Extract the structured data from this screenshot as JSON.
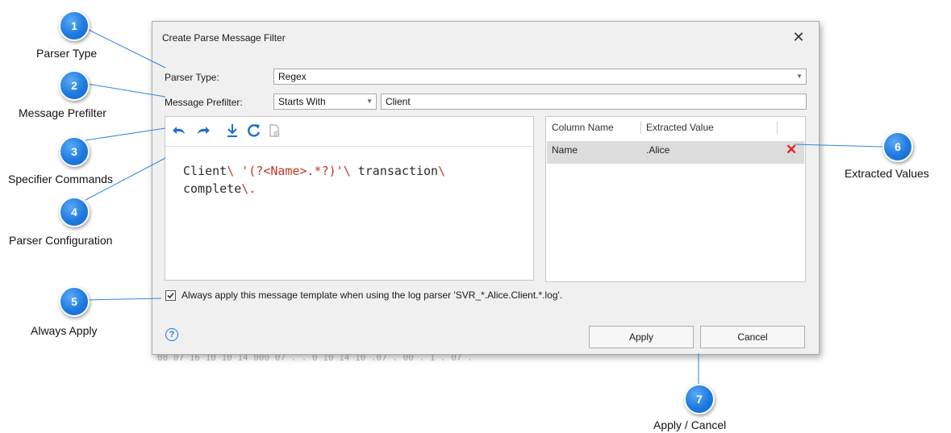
{
  "dialog": {
    "title": "Create Parse Message Filter",
    "close_glyph": "✕",
    "parser_type": {
      "label": "Parser Type:",
      "value": "Regex"
    },
    "message_prefilter": {
      "label": "Message Prefilter:",
      "mode": "Starts With",
      "value": "Client"
    },
    "editor": {
      "line1_a": "Client",
      "line1_b": "\\",
      " line1_c": "",
      "code_line1": [
        "Client",
        "\\ ",
        "'(?<Name>.*?)'",
        "\\ ",
        "transaction",
        "\\"
      ],
      "code_line2": [
        "complete",
        "\\."
      ]
    },
    "values_table": {
      "columns": [
        "Column Name",
        "Extracted Value"
      ],
      "rows": [
        {
          "name": "Name",
          "value": ".Alice"
        }
      ],
      "delete_glyph": "✕"
    },
    "always_apply": {
      "checked": true,
      "label": "Always apply this message template when using the log parser 'SVR_*.Alice.Client.*.log'."
    },
    "help_glyph": "?",
    "apply_label": "Apply",
    "cancel_label": "Cancel"
  },
  "toolbar_icons": [
    "undo-icon",
    "redo-icon",
    "download-icon",
    "refresh-icon",
    "add-document-icon"
  ],
  "callouts": [
    {
      "num": "1",
      "label": "Parser Type"
    },
    {
      "num": "2",
      "label": "Message Prefilter"
    },
    {
      "num": "3",
      "label": "Specifier Commands"
    },
    {
      "num": "4",
      "label": "Parser Configuration"
    },
    {
      "num": "5",
      "label": "Always Apply"
    },
    {
      "num": "6",
      "label": "Extracted Values"
    },
    {
      "num": "7",
      "label": "Apply / Cancel"
    }
  ],
  "colors": {
    "accent": "#1e7ae0",
    "delete": "#e02020",
    "escape": "#c0392b"
  }
}
